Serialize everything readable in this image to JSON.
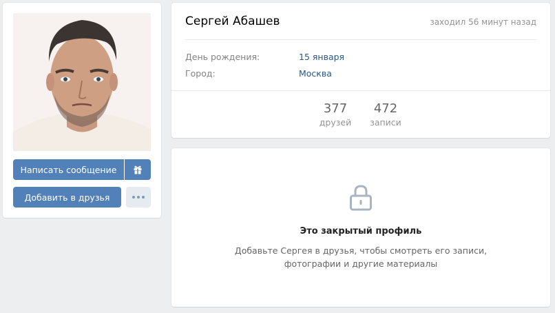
{
  "profile": {
    "name": "Сергей Абашев",
    "last_seen": "заходил 56 минут назад",
    "fields": [
      {
        "label": "День рождения:",
        "value": "15 января"
      },
      {
        "label": "Город:",
        "value": "Москва"
      }
    ],
    "counters": [
      {
        "value": "377",
        "caption": "друзей"
      },
      {
        "value": "472",
        "caption": "записи"
      }
    ]
  },
  "actions": {
    "message_label": "Написать сообщение",
    "add_friend_label": "Добавить в друзья",
    "gift_icon": "gift-icon",
    "more_icon": "more-dots-icon"
  },
  "closed": {
    "icon": "lock-icon",
    "title": "Это закрытый профиль",
    "text_line1": "Добавьте Сергея в друзья, чтобы смотреть его записи,",
    "text_line2": "фотографии и другие материалы"
  },
  "colors": {
    "accent": "#5181b8",
    "link": "#2a5885",
    "background": "#edeef0"
  }
}
